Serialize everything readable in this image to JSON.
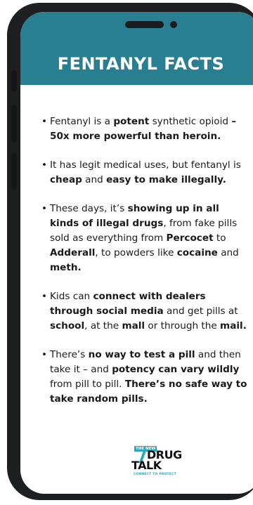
{
  "title": "FENTANYL FACTS",
  "colors": {
    "header": "#287f92",
    "phone_frame": "#1e1f21",
    "logo_accent": "#2aa6b6"
  },
  "bullets": [
    [
      {
        "text": "Fentanyl is a ",
        "bold": false
      },
      {
        "text": "potent",
        "bold": true
      },
      {
        "text": " synthetic opioid ",
        "bold": false
      },
      {
        "text": "– 50x more powerful than heroin.",
        "bold": true
      }
    ],
    [
      {
        "text": "It has legit medical uses, but fentanyl is ",
        "bold": false
      },
      {
        "text": "cheap",
        "bold": true
      },
      {
        "text": " and ",
        "bold": false
      },
      {
        "text": "easy to make illegally.",
        "bold": true
      }
    ],
    [
      {
        "text": "These days, it’s ",
        "bold": false
      },
      {
        "text": "showing up in all kinds of illegal drugs",
        "bold": true
      },
      {
        "text": ", from fake pills sold as everything from ",
        "bold": false
      },
      {
        "text": "Percocet",
        "bold": true
      },
      {
        "text": " to ",
        "bold": false
      },
      {
        "text": "Adderall",
        "bold": true
      },
      {
        "text": ", to powders like ",
        "bold": false
      },
      {
        "text": "cocaine",
        "bold": true
      },
      {
        "text": " and ",
        "bold": false
      },
      {
        "text": "meth.",
        "bold": true
      }
    ],
    [
      {
        "text": "Kids can ",
        "bold": false
      },
      {
        "text": "connect with dealers through social media",
        "bold": true
      },
      {
        "text": " and get pills at ",
        "bold": false
      },
      {
        "text": "school",
        "bold": true
      },
      {
        "text": ", at the ",
        "bold": false
      },
      {
        "text": "mall",
        "bold": true
      },
      {
        "text": " or through the ",
        "bold": false
      },
      {
        "text": "mail.",
        "bold": true
      }
    ],
    [
      {
        "text": "There’s ",
        "bold": false
      },
      {
        "text": "no way to test a pill",
        "bold": true
      },
      {
        "text": " and then take it – and ",
        "bold": false
      },
      {
        "text": "potency can vary wildly",
        "bold": true
      },
      {
        "text": " from pill to pill. ",
        "bold": false
      },
      {
        "text": "There’s no safe way to take random pills.",
        "bold": true
      }
    ]
  ],
  "logo": {
    "tag": "THE NEW",
    "line1": "DRUG",
    "line2": "TALK",
    "subtitle": "CONNECT TO PROTECT"
  }
}
